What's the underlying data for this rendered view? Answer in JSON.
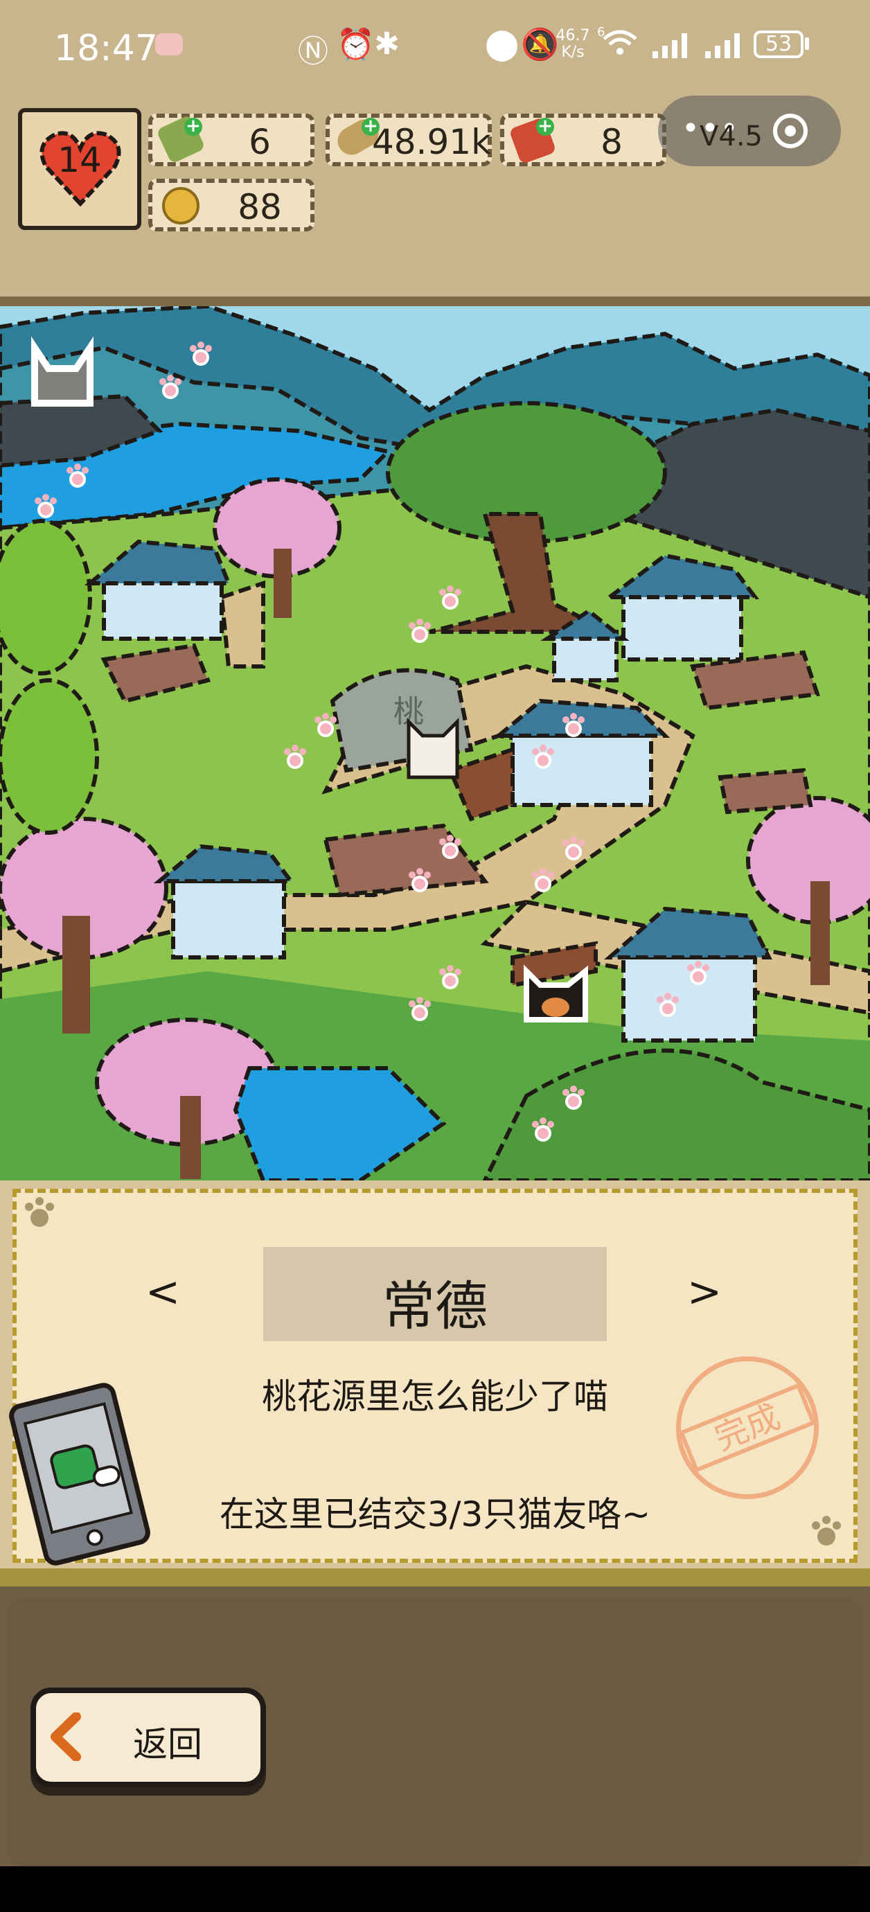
{
  "status_bar": {
    "time": "18:47",
    "network_speed": "46.7",
    "network_speed_unit": "K/s",
    "battery": "53",
    "signal_note": "6"
  },
  "resources": {
    "hearts": "14",
    "bottle": "6",
    "fish": "48.91k",
    "ticket": "8",
    "coin": "88"
  },
  "mini_program": {
    "version": "V4.5",
    "menu_icon": "more-dots-icon",
    "close_icon": "target-icon"
  },
  "scene": {
    "sign_char": "桃",
    "paw_count": 24
  },
  "location": {
    "prev": "<",
    "name": "常德",
    "next": ">",
    "description": "桃花源里怎么能少了喵",
    "progress": "在这里已结交3/3只猫友咯~",
    "stamp": "完成"
  },
  "footer": {
    "back_label": "返回"
  },
  "colors": {
    "accent": "#d9691d",
    "panel": "#c8b48d",
    "card": "#f6e5c3"
  }
}
